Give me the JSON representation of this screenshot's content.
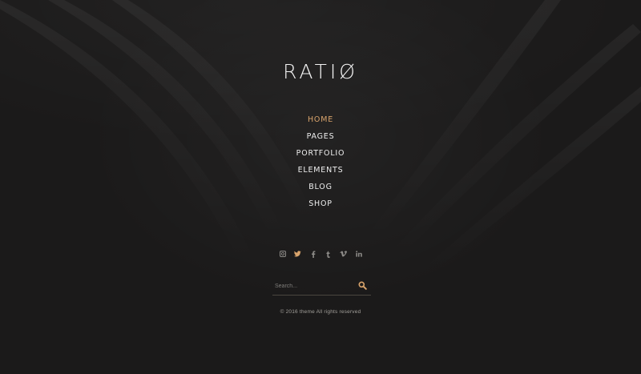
{
  "site": {
    "logo": "RATIØ"
  },
  "menu": {
    "items": [
      {
        "label": "HOME",
        "active": true
      },
      {
        "label": "PAGES",
        "active": false
      },
      {
        "label": "PORTFOLIO",
        "active": false
      },
      {
        "label": "ELEMENTS",
        "active": false
      },
      {
        "label": "BLOG",
        "active": false
      },
      {
        "label": "SHOP",
        "active": false
      }
    ]
  },
  "social": {
    "icons": [
      "instagram-icon",
      "twitter-icon",
      "facebook-icon",
      "tumblr-icon",
      "vimeo-icon",
      "linkedin-icon"
    ],
    "glyphs": [
      "◙",
      "🐦",
      "f",
      "t",
      "v",
      "in"
    ]
  },
  "search": {
    "placeholder": "Search...",
    "icon": "search-icon"
  },
  "footer": {
    "copyright": "© 2016 theme All rights reserved"
  },
  "colors": {
    "background": "#1b1a1a",
    "accent": "#d9a46c",
    "text": "#efefef"
  }
}
